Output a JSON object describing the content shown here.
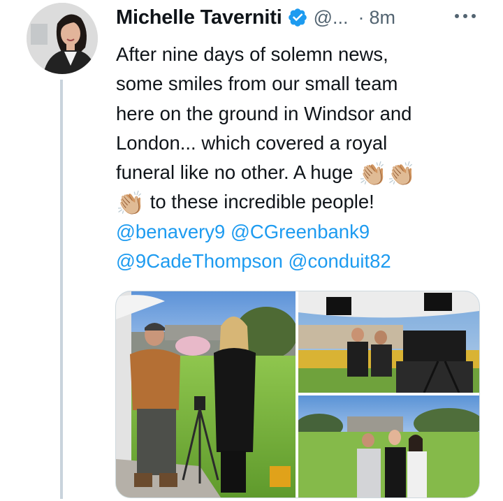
{
  "author": {
    "name": "Michelle Taverniti",
    "handle": "@...",
    "separator": "·",
    "time": "8m"
  },
  "icons": {
    "avatar": "profile-photo",
    "verified": "verified-badge-icon",
    "more": "more-options-icon"
  },
  "colors": {
    "text": "#0f1419",
    "secondary": "#536471",
    "link": "#1d9bf0",
    "verified": "#1d9bf0",
    "thread_line": "#c9d3dc",
    "media_border": "#cfd9de"
  },
  "tweet": {
    "line1": "After nine days of solemn news,",
    "line2": "some smiles from our small team",
    "line3": "here on the ground in Windsor and",
    "line4": "London... which covered a royal",
    "line5_text": "funeral like no other. A huge ",
    "line5_emoji": "👏🏼👏🏼",
    "line6_emoji": "👏🏼",
    "line6_text": " to these incredible people!",
    "mentions": [
      "@benavery9",
      "@CGreenbank9",
      "@9CadeThompson",
      "@conduit82"
    ]
  },
  "media": {
    "photos": [
      {
        "subject": "man-and-woman-on-lawn-with-camera-tripod"
      },
      {
        "subject": "two-men-at-camera-tent-with-flowers-and-palace"
      },
      {
        "subject": "four-people-on-lawn-with-palace-background"
      }
    ]
  }
}
